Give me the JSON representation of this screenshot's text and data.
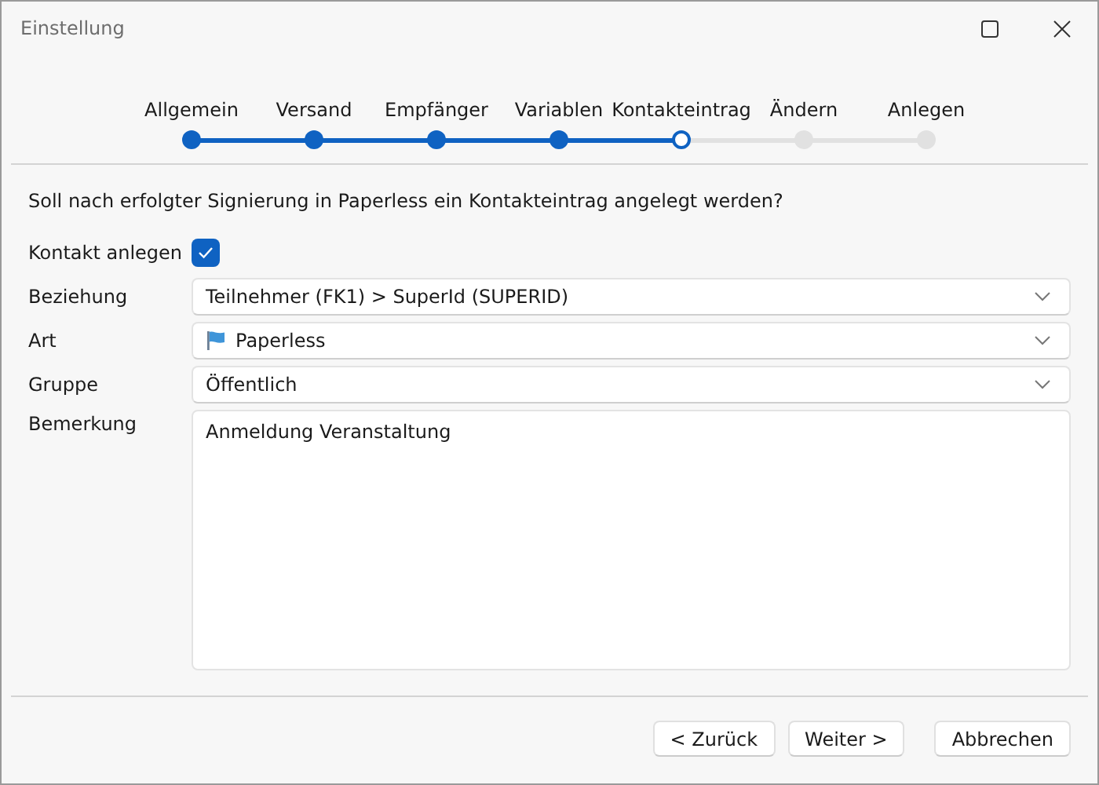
{
  "window": {
    "title": "Einstellung"
  },
  "steps": [
    {
      "label": "Allgemein",
      "completed": true,
      "selected": false
    },
    {
      "label": "Versand",
      "completed": true,
      "selected": false
    },
    {
      "label": "Empfänger",
      "completed": true,
      "selected": false
    },
    {
      "label": "Variablen",
      "completed": true,
      "selected": false
    },
    {
      "label": "Kontakteintrag",
      "completed": false,
      "selected": true
    },
    {
      "label": "Ändern",
      "completed": false,
      "selected": false
    },
    {
      "label": "Anlegen",
      "completed": false,
      "selected": false
    }
  ],
  "question": "Soll nach erfolgter Signierung in Paperless ein Kontakteintrag angelegt werden?",
  "fields": [
    {
      "kind": "checkbox",
      "label": "Kontakt anlegen",
      "checked": true
    },
    {
      "kind": "dropdown",
      "label": "Beziehung",
      "value": "Teilnehmer (FK1) > SuperId (SUPERID)"
    },
    {
      "kind": "flag_dropdown",
      "label": "Art",
      "value": "Paperless"
    },
    {
      "kind": "dropdown",
      "label": "Gruppe",
      "value": "Öffentlich"
    },
    {
      "kind": "textarea",
      "label": "Bemerkung",
      "value": "Anmeldung Veranstaltung"
    }
  ],
  "buttons": [
    {
      "label": "< Zurück",
      "kind": "back"
    },
    {
      "label": "Weiter >",
      "kind": "next"
    },
    {
      "label": "Abbrechen",
      "kind": "cancel"
    }
  ]
}
